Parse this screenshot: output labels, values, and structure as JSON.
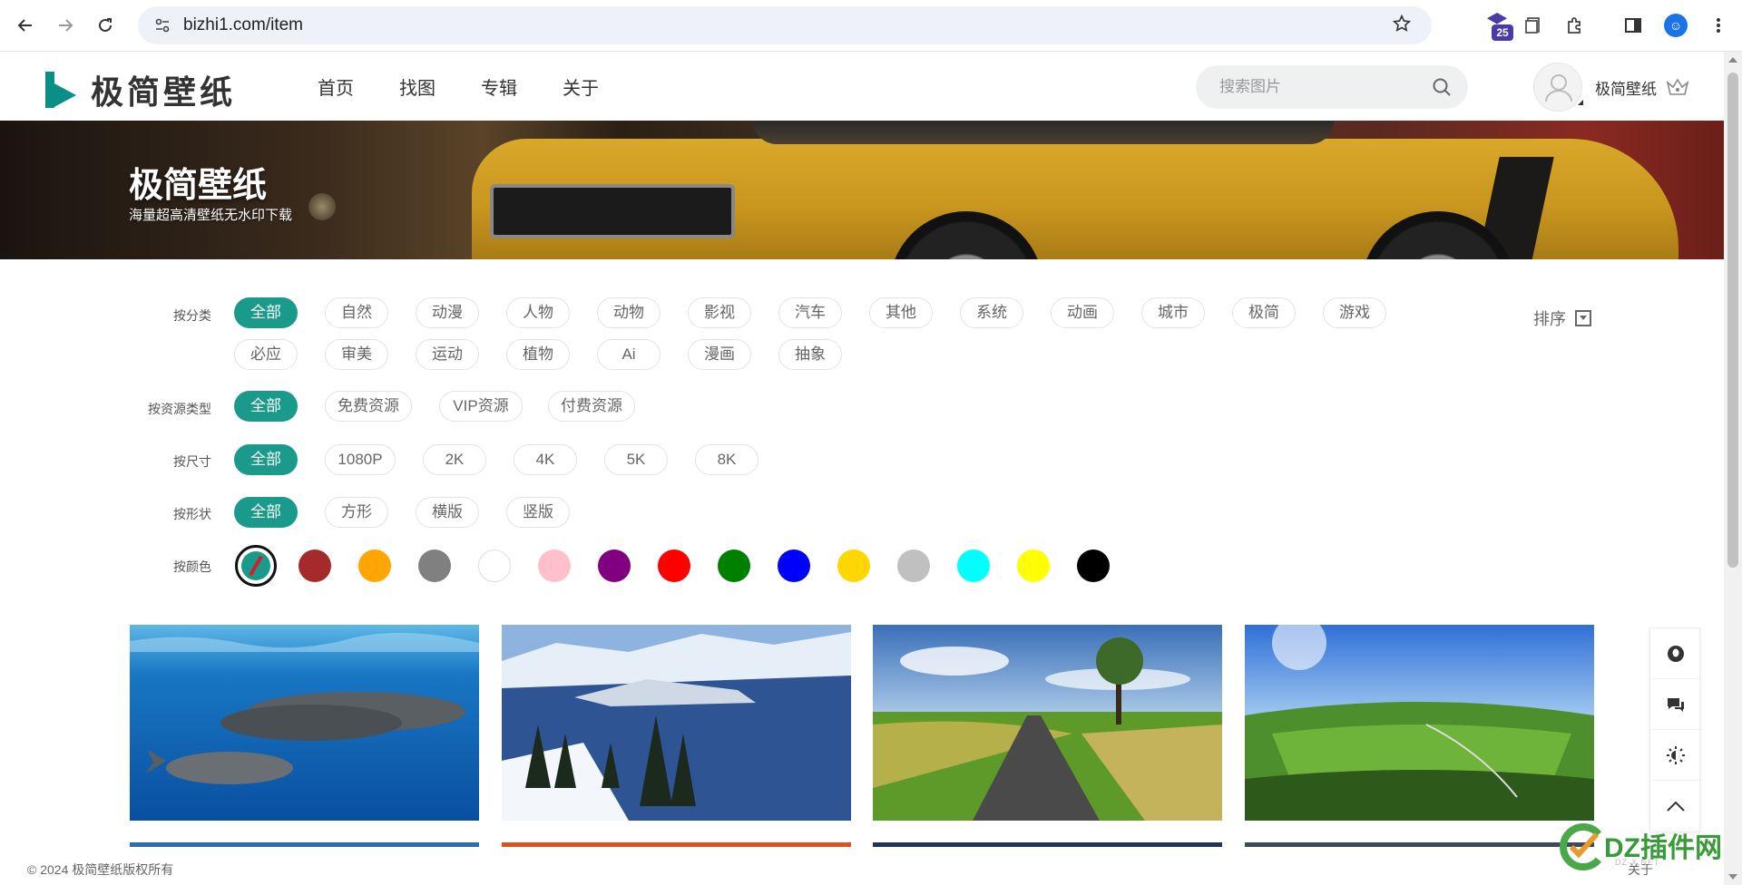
{
  "browser": {
    "url": "bizhi1.com/item",
    "extension_badge": "25"
  },
  "site": {
    "logo_text": "极简壁纸",
    "nav": [
      "首页",
      "找图",
      "专辑",
      "关于"
    ],
    "search_placeholder": "搜索图片",
    "username": "极简壁纸"
  },
  "hero": {
    "title": "极简壁纸",
    "subtitle": "海量超高清壁纸无水印下载"
  },
  "filters": {
    "category_label": "按分类",
    "categories_row1": [
      "全部",
      "自然",
      "动漫",
      "人物",
      "动物",
      "影视",
      "汽车",
      "其他",
      "系统",
      "动画",
      "城市",
      "极简",
      "游戏"
    ],
    "categories_row2": [
      "必应",
      "审美",
      "运动",
      "植物",
      "Ai",
      "漫画",
      "抽象"
    ],
    "resource_label": "按资源类型",
    "resources": [
      "全部",
      "免费资源",
      "VIP资源",
      "付费资源"
    ],
    "size_label": "按尺寸",
    "sizes": [
      "全部",
      "1080P",
      "2K",
      "4K",
      "5K",
      "8K"
    ],
    "shape_label": "按形状",
    "shapes": [
      "全部",
      "方形",
      "横版",
      "竖版"
    ],
    "color_label": "按颜色",
    "colors": [
      "#a52a2a",
      "#ffa500",
      "#808080",
      "#ffffff",
      "#ffc0cb",
      "#800080",
      "#ff0000",
      "#008000",
      "#0000ff",
      "#ffd700",
      "#c0c0c0",
      "#00ffff",
      "#ffff00",
      "#000000"
    ],
    "sort_label": "排序"
  },
  "footer": {
    "copyright": "© 2024 极简壁纸版权所有",
    "about": "关于"
  },
  "watermark": {
    "text": "DZ插件网",
    "sub": "DZ-X.NET"
  }
}
